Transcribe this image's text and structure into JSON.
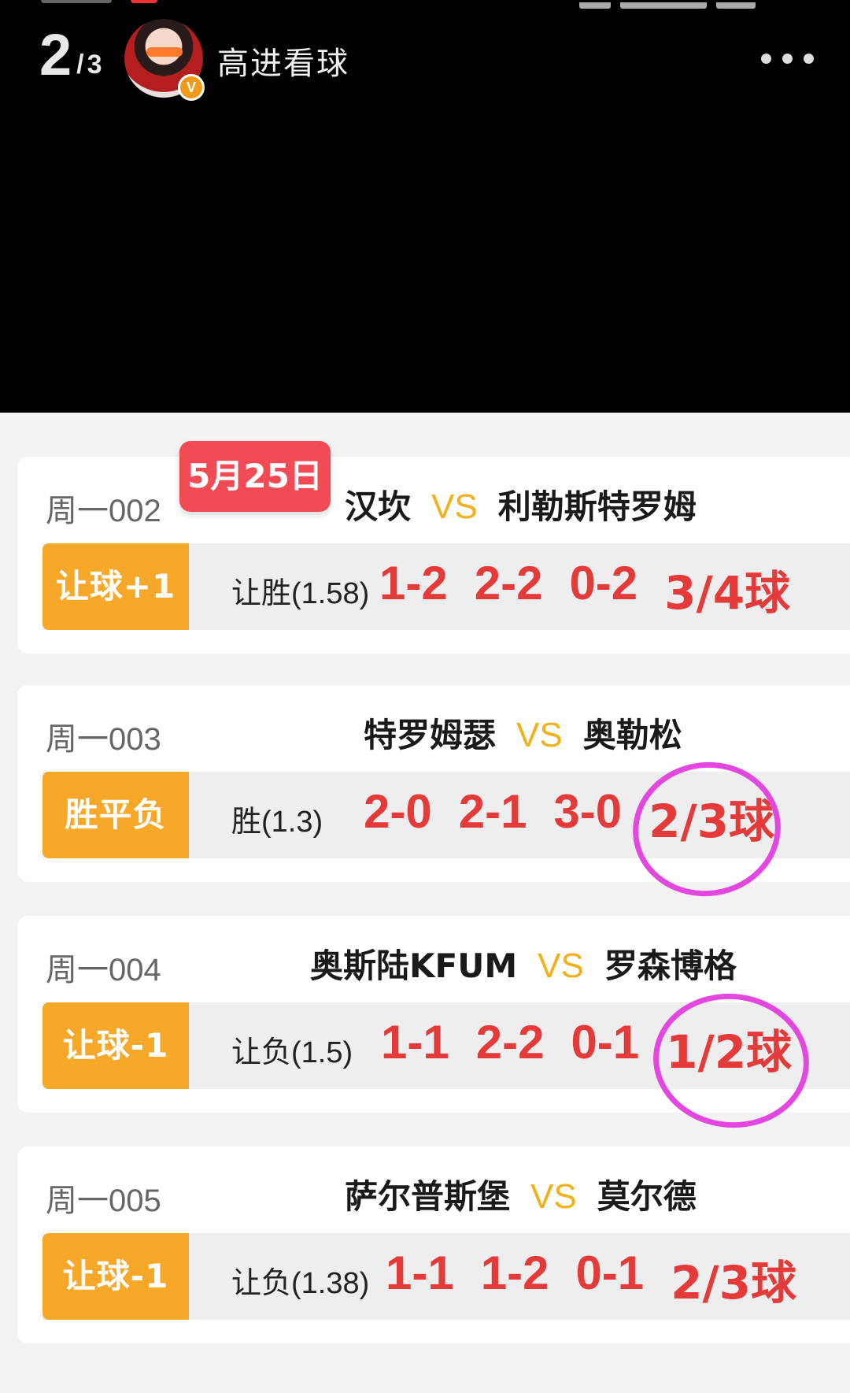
{
  "header": {
    "page_current": "2",
    "page_separator": "/",
    "page_total": "3",
    "username": "高进看球",
    "verified_badge": "V",
    "more_icon": "more-horizontal-icon"
  },
  "date_badge": "5月25日",
  "matches": [
    {
      "code": "周一002",
      "home": "汉坎",
      "vs": "VS",
      "away": "利勒斯特罗姆",
      "bet_type": "让球+1",
      "pick_label": "让胜",
      "pick_odds": "(1.58)",
      "scores": [
        "1-2",
        "2-2",
        "0-2"
      ],
      "goals": "3/4球"
    },
    {
      "code": "周一003",
      "home": "特罗姆瑟",
      "vs": "VS",
      "away": "奥勒松",
      "bet_type": "胜平负",
      "pick_label": "胜",
      "pick_odds": "(1.3)",
      "scores": [
        "2-0",
        "2-1",
        "3-0"
      ],
      "goals": "2/3球"
    },
    {
      "code": "周一004",
      "home": "奥斯陆KFUM",
      "vs": "VS",
      "away": "罗森博格",
      "bet_type": "让球-1",
      "pick_label": "让负",
      "pick_odds": "(1.5)",
      "scores": [
        "1-1",
        "2-2",
        "0-1"
      ],
      "goals": "1/2球"
    },
    {
      "code": "周一005",
      "home": "萨尔普斯堡",
      "vs": "VS",
      "away": "莫尔德",
      "bet_type": "让球-1",
      "pick_label": "让负",
      "pick_odds": "(1.38)",
      "scores": [
        "1-1",
        "1-2",
        "0-1"
      ],
      "goals": "2/3球"
    }
  ],
  "colors": {
    "tag_orange": "#f7a829",
    "score_red": "#e53a3a",
    "vs_gold": "#f2b11a",
    "date_red": "#f24b55",
    "annotation_magenta": "#e447e0"
  }
}
